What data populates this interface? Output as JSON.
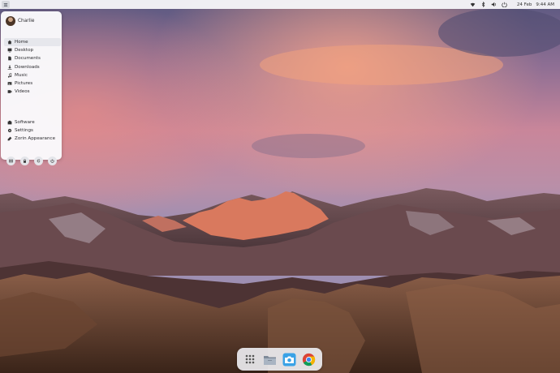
{
  "topbar": {
    "date": "24 Feb",
    "time": "9:44 AM",
    "tray_icons": [
      "wifi-icon",
      "bluetooth-icon",
      "volume-icon",
      "power-icon"
    ]
  },
  "start_menu": {
    "user_name": "Charlie",
    "places": [
      {
        "label": "Home",
        "icon": "home-icon",
        "active": true
      },
      {
        "label": "Desktop",
        "icon": "desktop-icon"
      },
      {
        "label": "Documents",
        "icon": "document-icon"
      },
      {
        "label": "Downloads",
        "icon": "download-icon"
      },
      {
        "label": "Music",
        "icon": "music-icon"
      },
      {
        "label": "Pictures",
        "icon": "pictures-icon"
      },
      {
        "label": "Videos",
        "icon": "video-icon"
      }
    ],
    "tools": [
      {
        "label": "Software",
        "icon": "software-icon"
      },
      {
        "label": "Settings",
        "icon": "settings-icon"
      },
      {
        "label": "Zorin Appearance",
        "icon": "appearance-icon"
      }
    ],
    "power_buttons": [
      "screenshot-icon",
      "lock-icon",
      "restart-icon",
      "power-icon"
    ]
  },
  "dock": {
    "items": [
      "app-grid-icon",
      "files-icon",
      "camera-icon",
      "chrome-icon"
    ]
  },
  "colors": {
    "accent": "#3aa2e6",
    "panel": "#f5f5f8"
  }
}
